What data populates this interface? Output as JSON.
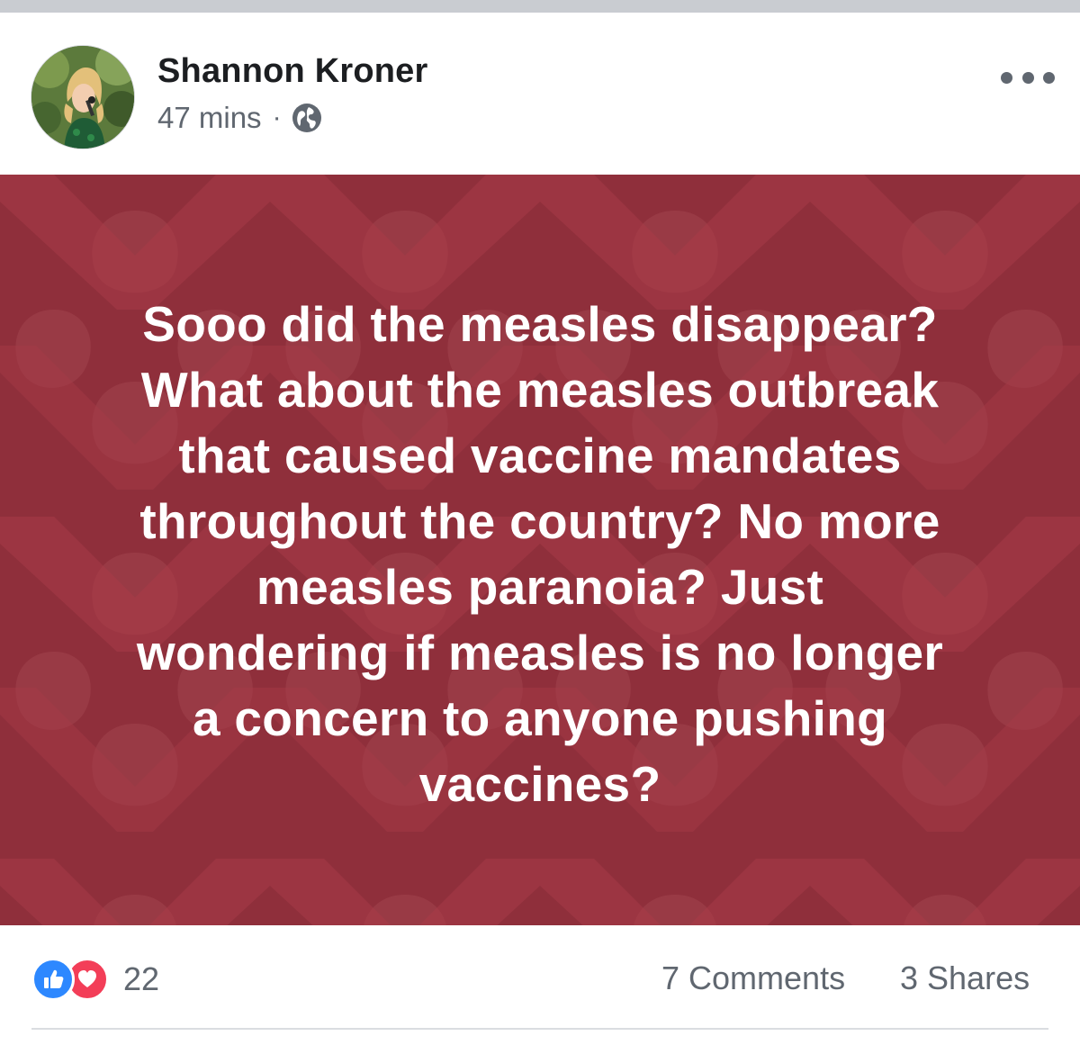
{
  "post": {
    "author": "Shannon Kroner",
    "time": "47 mins",
    "separator": "·",
    "privacy_icon": "globe-icon",
    "more_icon": "more-options-icon",
    "background_color": "#8f2f3b",
    "text_lines": [
      "Sooo did the measles disappear?",
      "What about the measles outbreak",
      "that caused vaccine mandates",
      "throughout the country? No more",
      "measles paranoia? Just",
      "wondering if measles is no longer",
      "a concern to anyone pushing",
      "vaccines?"
    ]
  },
  "footer": {
    "reaction_icons": [
      "like-icon",
      "love-icon"
    ],
    "reaction_count": "22",
    "comments": "7 Comments",
    "shares": "3 Shares"
  },
  "colors": {
    "like": "#2d88ff",
    "love": "#f33e58",
    "meta_text": "#606770",
    "name_text": "#1c1e21"
  }
}
